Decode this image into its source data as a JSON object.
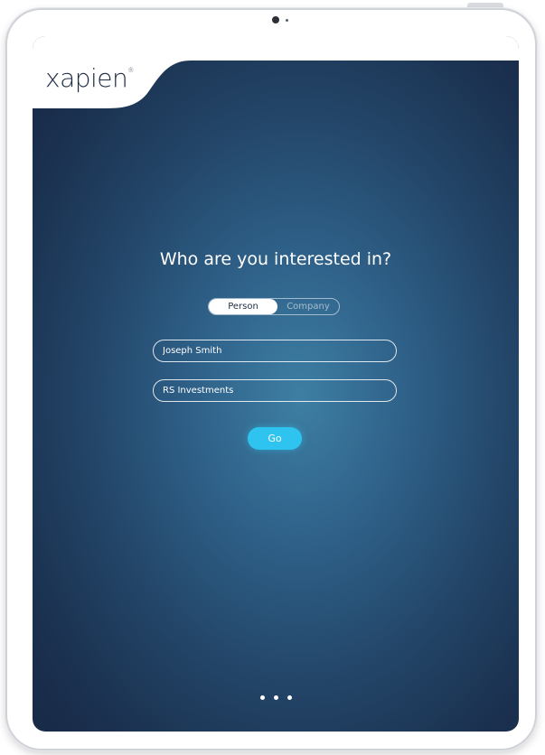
{
  "app": {
    "logo_text": "xapien",
    "logo_mark": "®"
  },
  "main": {
    "question": "Who are you interested in?",
    "toggle": {
      "options": [
        "Person",
        "Company"
      ],
      "selected": "Person"
    },
    "fields": [
      {
        "value": "Joseph Smith"
      },
      {
        "value": "RS Investments"
      }
    ],
    "go_label": "Go"
  },
  "pagination": {
    "dot_count": 3
  },
  "colors": {
    "accent": "#2ec4ef",
    "background_dark": "#172844",
    "background_light": "#3e7fa3",
    "logo": "#1d2a44"
  }
}
